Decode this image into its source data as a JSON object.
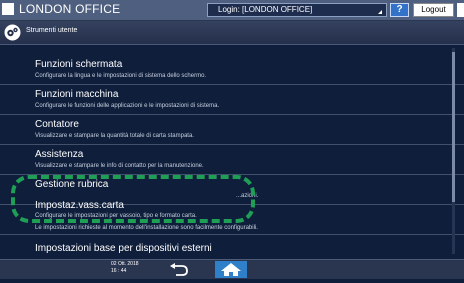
{
  "header": {
    "title": "LONDON OFFICE",
    "login": "Login: [LONDON OFFICE]",
    "help_label": "?",
    "logout_label": "Logout"
  },
  "subheader": {
    "label": "Strumenti utente"
  },
  "list": {
    "items": [
      {
        "title": "Funzioni schermata",
        "desc": "Configurare la lingua e le impostazioni di sistema dello schermo."
      },
      {
        "title": "Funzioni macchina",
        "desc": "Configurare le funzioni delle applicazioni e le impostazioni di sistema."
      },
      {
        "title": "Contatore",
        "desc": "Visualizzare e stampare la quantità totale di carta stampata."
      },
      {
        "title": "Assistenza",
        "desc": "Visualizzare e stampare le info di contatto per la manutenzione."
      },
      {
        "title": "Gestione rubrica",
        "desc": "...azioni."
      },
      {
        "title": "Impostaz.vass.carta",
        "desc": "Configurare le impostazioni per vassoio, tipo e formato carta."
      },
      {
        "title": "",
        "desc": "Le impostazioni richieste al momento dell'installazione sono facilmente configurabili."
      },
      {
        "title": "Impostazioni base per dispositivi esterni",
        "desc": ""
      }
    ]
  },
  "footer": {
    "date": "02 Ott. 2018",
    "time": "16 : 44"
  },
  "colors": {
    "highlight": "#1f9e55",
    "home_button": "#2f7fc9",
    "help_button": "#3273c9"
  }
}
